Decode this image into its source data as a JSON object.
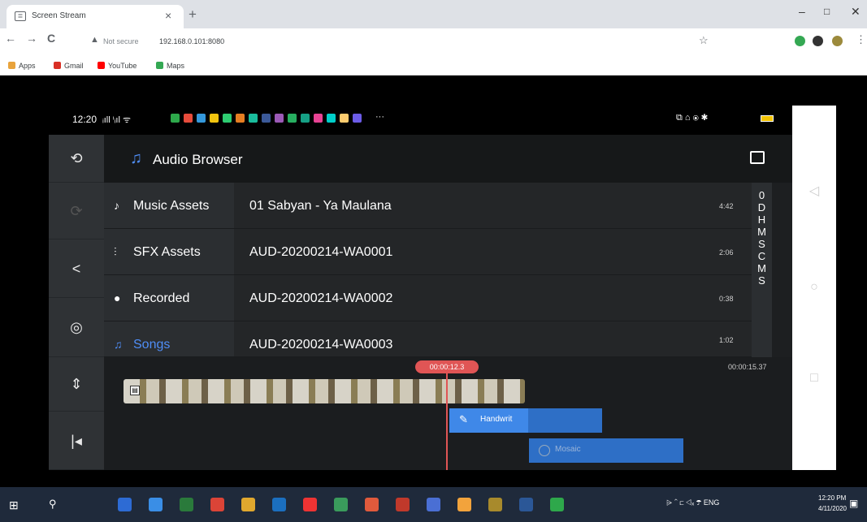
{
  "browser": {
    "tab_title": "Screen Stream",
    "tab_close": "×",
    "new_tab": "+",
    "win_min": "–",
    "win_max": "□",
    "win_close": "✕",
    "back": "←",
    "forward": "→",
    "reload": "C",
    "security_icon": "▲",
    "security_text": "Not secure",
    "url": "192.168.0.101:8080",
    "star": "☆",
    "menu": "⋮",
    "bookmarks": [
      {
        "label": "Apps",
        "color": "#e8a33c"
      },
      {
        "label": "Gmail",
        "color": "#d93025"
      },
      {
        "label": "YouTube",
        "color": "#ff0000"
      },
      {
        "label": "Maps",
        "color": "#34a853"
      }
    ]
  },
  "phone": {
    "status_time": "12:20",
    "status_signal": "ᵢıll ⁱᵢıl ᯤ",
    "status_right": "⧉ ⌂ ⦿ ✱",
    "status_more": "···"
  },
  "app": {
    "header_title": "Audio Browser",
    "check": "✓",
    "left_buttons": [
      "⟲",
      "⟳",
      "<",
      "◎",
      "⇕",
      "|◂"
    ],
    "categories": [
      {
        "icon": "♪",
        "label": "Music Assets",
        "active": false
      },
      {
        "icon": "⫶",
        "label": "SFX Assets",
        "active": false
      },
      {
        "icon": "●",
        "label": "Recorded",
        "active": false
      },
      {
        "icon": "♫",
        "label": "Songs",
        "active": true
      }
    ],
    "tracks": [
      {
        "name": "01 Sabyan - Ya Maulana",
        "duration": "4:42"
      },
      {
        "name": "AUD-20200214-WA0001",
        "duration": "2:06"
      },
      {
        "name": "AUD-20200214-WA0002",
        "duration": "0:38"
      },
      {
        "name": "AUD-20200214-WA0003",
        "duration": "1:02"
      }
    ],
    "alpha_index": [
      "0",
      "D",
      "H",
      "M",
      "S",
      "C",
      "M",
      "S"
    ],
    "timeline": {
      "playhead_time": "00:00:12.3",
      "end_time": "00:00:15.37",
      "handwriting_label": "Handwrit",
      "mosaic_label": "Mosaic"
    }
  },
  "android_nav": [
    "◁",
    "○",
    "□"
  ],
  "taskbar": {
    "start": "⊞",
    "search": "⚲",
    "tray": "⩥ ⌃ ⊏ ◁ₓ ☂ ENG",
    "clock_time": "12:20 PM",
    "clock_date": "4/11/2020",
    "notif": "▣",
    "icons": [
      "#2d6bd4",
      "#3a8ee6",
      "#2a7a3b",
      "#db4437",
      "#e0a82e",
      "#1b6fbf",
      "#e33",
      "#3a9b5c",
      "#e05a3c",
      "#c0392b",
      "#4a6fd4",
      "#f2a33c",
      "#a88a2c",
      "#2b5797",
      "#2ea84b"
    ]
  }
}
